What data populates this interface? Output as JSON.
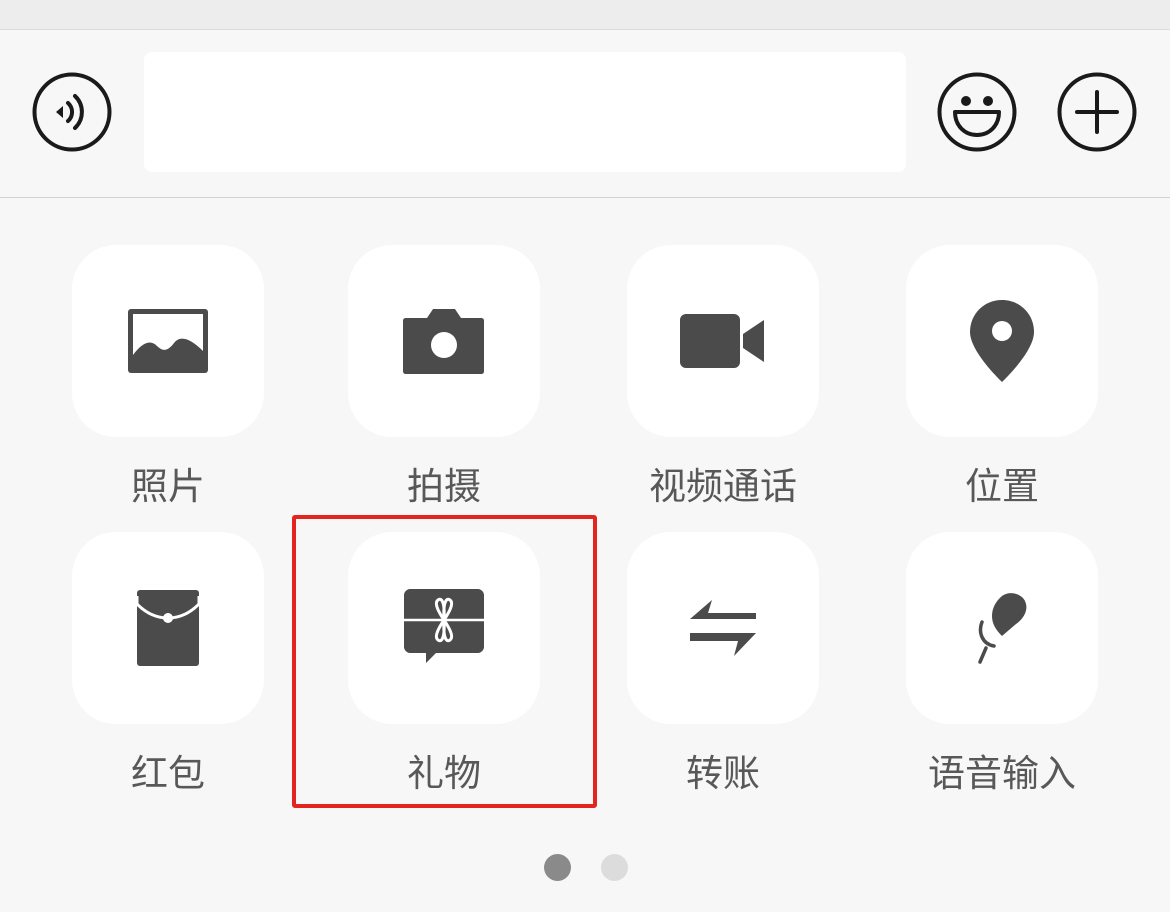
{
  "input_bar": {
    "message_value": "",
    "voice_icon": "voice-input-icon",
    "emoji_icon": "smiley-icon",
    "plus_icon": "plus-icon"
  },
  "panel": {
    "items": [
      {
        "label": "照片",
        "icon": "photo-icon"
      },
      {
        "label": "拍摄",
        "icon": "camera-icon"
      },
      {
        "label": "视频通话",
        "icon": "video-call-icon"
      },
      {
        "label": "位置",
        "icon": "location-pin-icon"
      },
      {
        "label": "红包",
        "icon": "red-packet-icon"
      },
      {
        "label": "礼物",
        "icon": "gift-icon"
      },
      {
        "label": "转账",
        "icon": "transfer-icon"
      },
      {
        "label": "语音输入",
        "icon": "microphone-icon"
      }
    ],
    "highlighted_item": "礼物"
  },
  "pagination": {
    "pages": 2,
    "current_page": 1
  },
  "colors": {
    "background": "#f7f7f7",
    "tile": "#ffffff",
    "icon": "#4b4b4b",
    "label": "#585858",
    "highlight_border": "#e2261f",
    "dot_active": "#8a8a8a",
    "dot_inactive": "#dcdcdc"
  }
}
